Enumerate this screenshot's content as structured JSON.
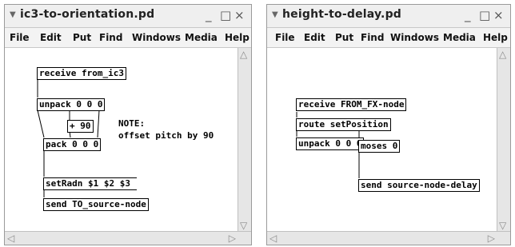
{
  "window1": {
    "title": "ic3-to-orientation.pd",
    "controls": [
      "_",
      "□",
      "×"
    ],
    "menu": [
      "File",
      "Edit",
      "Put",
      "Find",
      "Windows",
      "Media",
      "Help"
    ],
    "objects": {
      "receive": "receive from_ic3",
      "unpack": "unpack 0 0 0",
      "plus": "+ 90",
      "pack": "pack 0 0 0",
      "msg": "setRadn $1 $2 $3",
      "send": "send TO_source-node"
    },
    "note": "NOTE:\noffset pitch by 90"
  },
  "window2": {
    "title": "height-to-delay.pd",
    "controls": [
      "_",
      "□",
      "×"
    ],
    "menu": [
      "File",
      "Edit",
      "Put",
      "Find",
      "Windows",
      "Media",
      "Help"
    ],
    "objects": {
      "receive": "receive FROM_FX-node",
      "route": "route setPosition",
      "unpack": "unpack 0 0 0",
      "moses": "moses 0",
      "send": "send source-node-delay"
    }
  }
}
